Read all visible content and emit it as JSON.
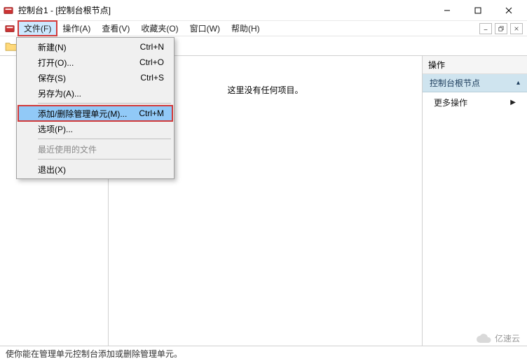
{
  "titlebar": {
    "text": "控制台1 - [控制台根节点]"
  },
  "menubar": {
    "file": "文件(F)",
    "action": "操作(A)",
    "view": "查看(V)",
    "favorites": "收藏夹(O)",
    "window": "窗口(W)",
    "help": "帮助(H)"
  },
  "dropdown": {
    "new_": {
      "label": "新建(N)",
      "shortcut": "Ctrl+N"
    },
    "open": {
      "label": "打开(O)...",
      "shortcut": "Ctrl+O"
    },
    "save": {
      "label": "保存(S)",
      "shortcut": "Ctrl+S"
    },
    "saveas": {
      "label": "另存为(A)..."
    },
    "addremove": {
      "label": "添加/删除管理单元(M)...",
      "shortcut": "Ctrl+M"
    },
    "options": {
      "label": "选项(P)..."
    },
    "recent": {
      "label": "最近使用的文件"
    },
    "exit": {
      "label": "退出(X)"
    }
  },
  "center": {
    "empty_text": "这里没有任何项目。"
  },
  "actions": {
    "panel_title": "操作",
    "section": "控制台根节点",
    "more": "更多操作"
  },
  "statusbar": {
    "text": "使你能在管理单元控制台添加或删除管理单元。"
  },
  "watermark": {
    "text": "亿速云"
  }
}
